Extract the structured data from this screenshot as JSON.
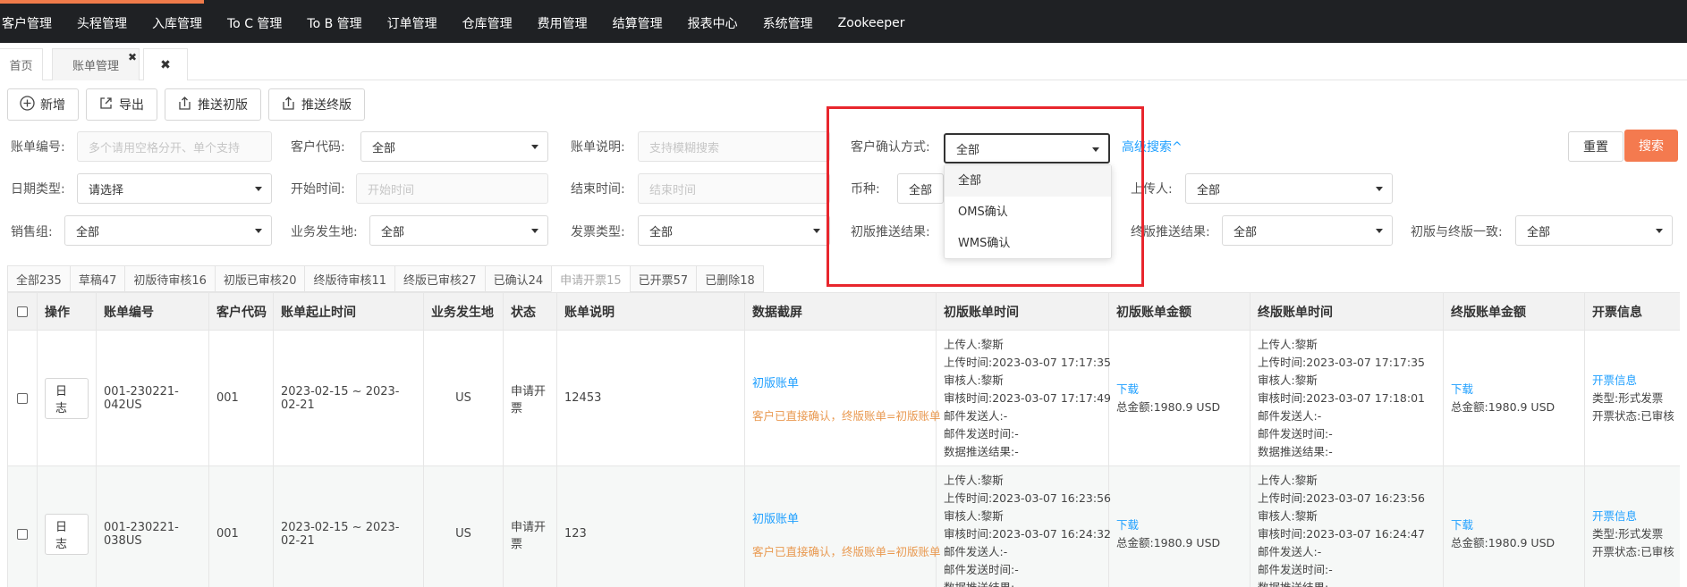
{
  "nav": [
    "客户管理",
    "头程管理",
    "入库管理",
    "To C 管理",
    "To B 管理",
    "订单管理",
    "仓库管理",
    "费用管理",
    "结算管理",
    "报表中心",
    "系统管理",
    "Zookeeper"
  ],
  "page_tabs": {
    "home": "首页",
    "bill": "账单管理",
    "close_mark": "✖",
    "closer": "✖"
  },
  "toolbar": {
    "add": "新增",
    "export": "导出",
    "push_initial": "推送初版",
    "push_final": "推送终版"
  },
  "filters": {
    "bill_no": {
      "label": "账单编号:",
      "placeholder": "多个请用空格分开、单个支持"
    },
    "customer_code": {
      "label": "客户代码:",
      "value": "全部"
    },
    "bill_desc": {
      "label": "账单说明:",
      "placeholder": "支持模糊搜索"
    },
    "confirm_method": {
      "label": "客户确认方式:",
      "value": "全部"
    },
    "date_type": {
      "label": "日期类型:",
      "value": "请选择"
    },
    "start_time": {
      "label": "开始时间:",
      "placeholder": "开始时间"
    },
    "end_time": {
      "label": "结束时间:",
      "placeholder": "结束时间"
    },
    "currency": {
      "label": "币种:",
      "value": "全部"
    },
    "uploader": {
      "label": "上传人:",
      "value": "全部"
    },
    "sales_group": {
      "label": "销售组:",
      "value": "全部"
    },
    "biz_location": {
      "label": "业务发生地:",
      "value": "全部"
    },
    "invoice_type": {
      "label": "发票类型:",
      "value": "全部"
    },
    "initial_push_result": {
      "label": "初版推送结果:"
    },
    "final_push_result": {
      "label": "终版推送结果:",
      "value": "全部"
    },
    "consistency": {
      "label": "初版与终版一致:",
      "value": "全部"
    }
  },
  "advanced_search": "高级搜索^",
  "buttons": {
    "reset": "重置",
    "search": "搜索"
  },
  "dropdown_options": [
    "全部",
    "OMS确认",
    "WMS确认"
  ],
  "status_tabs": [
    "全部235",
    "草稿47",
    "初版待审核16",
    "初版已审核20",
    "终版待审核11",
    "终版已审核27",
    "已确认24",
    "申请开票15",
    "已开票57",
    "已删除18"
  ],
  "table": {
    "headers": [
      "操作",
      "账单编号",
      "客户代码",
      "账单起止时间",
      "业务发生地",
      "状态",
      "账单说明",
      "数据截屏",
      "初版账单时间",
      "初版账单金额",
      "终版账单时间",
      "终版账单金额",
      "开票信息"
    ],
    "rows": [
      {
        "log": "日志",
        "bill_no": "001-230221-042US",
        "customer": "001",
        "period": "2023-02-15 ~ 2023-02-21",
        "location": "US",
        "status": "申请开票",
        "desc": "12453",
        "screenshot_link": "初版账单",
        "screenshot_note": "客户已直接确认，终版账单=初版账单",
        "initial_time": [
          "上传人:黎斯",
          "上传时间:2023-03-07 17:17:35",
          "审核人:黎斯",
          "审核时间:2023-03-07 17:17:49",
          "邮件发送人:-",
          "邮件发送时间:-",
          "数据推送结果:-"
        ],
        "initial_download": "下载",
        "initial_amount": "总金额:1980.9 USD",
        "final_time": [
          "上传人:黎斯",
          "上传时间:2023-03-07 17:17:35",
          "审核人:黎斯",
          "审核时间:2023-03-07 17:18:01",
          "邮件发送人:-",
          "邮件发送时间:-",
          "数据推送结果:-"
        ],
        "final_download": "下载",
        "final_amount": "总金额:1980.9 USD",
        "invoice_link": "开票信息",
        "invoice_type": "类型:形式发票",
        "invoice_status": "开票状态:已审核"
      },
      {
        "log": "日志",
        "bill_no": "001-230221-038US",
        "customer": "001",
        "period": "2023-02-15 ~ 2023-02-21",
        "location": "US",
        "status": "申请开票",
        "desc": "123",
        "screenshot_link": "初版账单",
        "screenshot_note": "客户已直接确认，终版账单=初版账单",
        "initial_time": [
          "上传人:黎斯",
          "上传时间:2023-03-07 16:23:56",
          "审核人:黎斯",
          "审核时间:2023-03-07 16:24:32",
          "邮件发送人:-",
          "邮件发送时间:-",
          "数据推送结果:-"
        ],
        "initial_download": "下载",
        "initial_amount": "总金额:1980.9 USD",
        "final_time": [
          "上传人:黎斯",
          "上传时间:2023-03-07 16:23:56",
          "审核人:黎斯",
          "审核时间:2023-03-07 16:24:47",
          "邮件发送人:-",
          "邮件发送时间:-",
          "数据推送结果:-"
        ],
        "final_download": "下载",
        "final_amount": "总金额:1980.9 USD",
        "invoice_link": "开票信息",
        "invoice_type": "类型:形式发票",
        "invoice_status": "开票状态:已审核"
      }
    ]
  }
}
